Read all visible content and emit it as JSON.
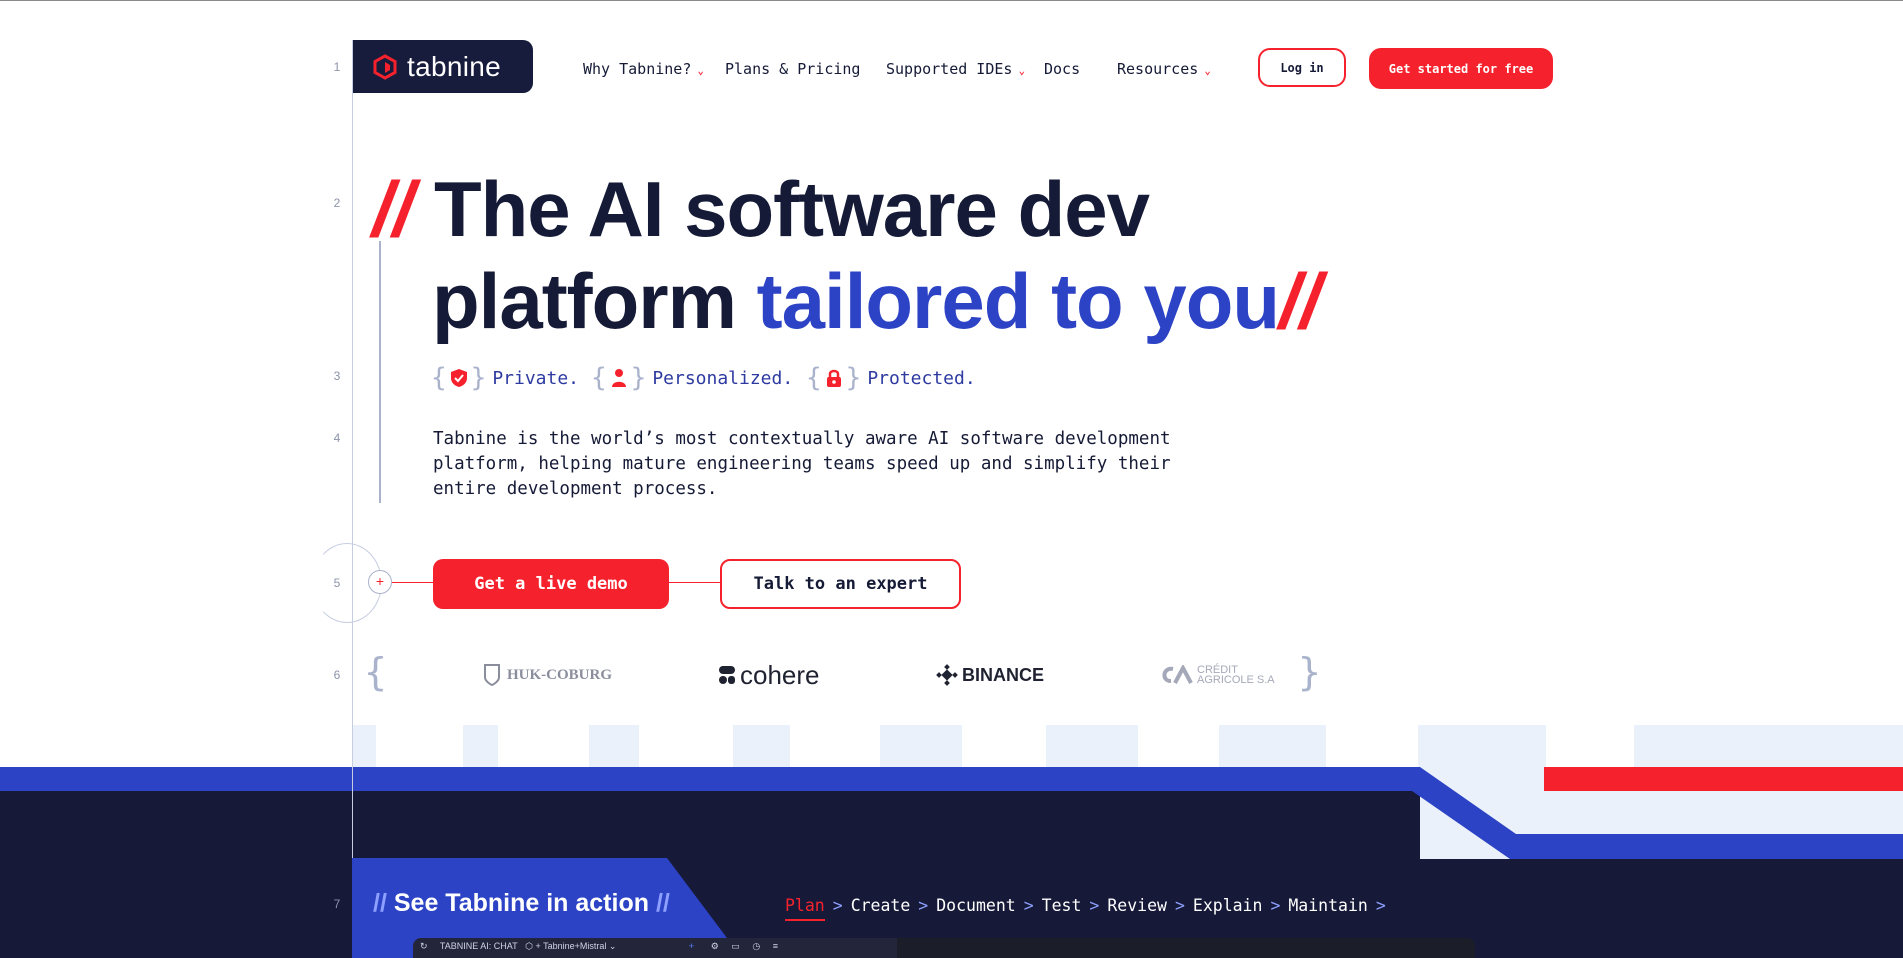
{
  "nav": {
    "logo_text": "tabnine",
    "items": [
      {
        "label": "Why Tabnine?",
        "has_dropdown": true
      },
      {
        "label": "Plans & Pricing",
        "has_dropdown": false
      },
      {
        "label": "Supported IDEs",
        "has_dropdown": true
      },
      {
        "label": "Docs",
        "has_dropdown": false
      },
      {
        "label": "Resources",
        "has_dropdown": true
      }
    ],
    "login_label": "Log in",
    "get_started_label": "Get started for free"
  },
  "line_numbers": [
    "1",
    "2",
    "3",
    "4",
    "5",
    "6",
    "7"
  ],
  "hero": {
    "slash_open": "//",
    "line1": "The AI software dev",
    "line2_plain": "platform ",
    "line2_accent": "tailored to you",
    "slash_close": "//",
    "features": [
      {
        "icon": "shield-check-icon",
        "label": "Private."
      },
      {
        "icon": "person-icon",
        "label": "Personalized."
      },
      {
        "icon": "lock-icon",
        "label": "Protected."
      }
    ],
    "description": "Tabnine is the world’s most contextually aware AI software development platform, helping mature engineering teams speed up and simplify their entire development process.",
    "demo_button": "Get a live demo",
    "expert_button": "Talk to an expert"
  },
  "customers": [
    "HUK-COBURG",
    "cohere",
    "BINANCE",
    "CRÉDIT AGRICOLE S.A"
  ],
  "action": {
    "slash_open": "//",
    "title": "See Tabnine in action",
    "slash_close": "//",
    "steps": [
      "Plan",
      "Create",
      "Document",
      "Test",
      "Review",
      "Explain",
      "Maintain"
    ],
    "active_step": "Plan",
    "ide_title": "TABNINE AI: CHAT",
    "ide_model": "Tabnine+Mistral"
  },
  "colors": {
    "navy": "#151a36",
    "brand_red": "#f5222d",
    "accent_blue": "#2d43c6",
    "light_blue": "#ebf1fb"
  }
}
